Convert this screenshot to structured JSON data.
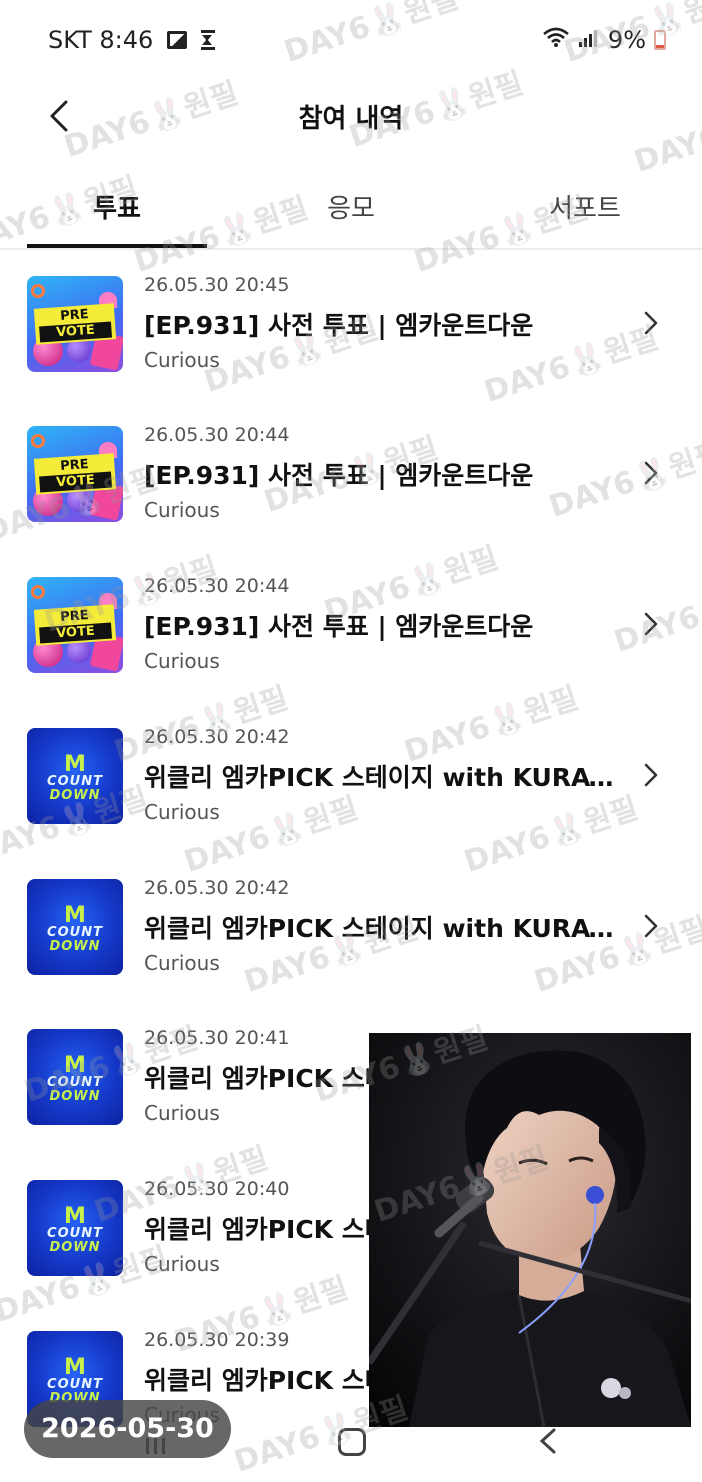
{
  "status_bar": {
    "carrier_time": "SKT 8:46",
    "battery": "9%"
  },
  "header": {
    "title": "참여 내역"
  },
  "tabs": [
    {
      "label": "투표",
      "active": true
    },
    {
      "label": "응모",
      "active": false
    },
    {
      "label": "서포트",
      "active": false
    }
  ],
  "thumbnails": {
    "pre_vote": {
      "line1": "PRE",
      "line2": "VOTE"
    },
    "countdown": {
      "m": "M",
      "line1": "COUNT",
      "line2": "DOWN"
    }
  },
  "items": [
    {
      "date": "26.05.30 20:45",
      "title": "[EP.931] 사전 투표 | 엠카운트다운",
      "subtitle": "Curious",
      "thumb": "pre_vote"
    },
    {
      "date": "26.05.30 20:44",
      "title": "[EP.931] 사전 투표 | 엠카운트다운",
      "subtitle": "Curious",
      "thumb": "pre_vote"
    },
    {
      "date": "26.05.30 20:44",
      "title": "[EP.931] 사전 투표 | 엠카운트다운",
      "subtitle": "Curious",
      "thumb": "pre_vote"
    },
    {
      "date": "26.05.30 20:42",
      "title": "위클리 엠카PICK 스테이지 with KURAT...",
      "subtitle": "Curious",
      "thumb": "countdown"
    },
    {
      "date": "26.05.30 20:42",
      "title": "위클리 엠카PICK 스테이지 with KURAT...",
      "subtitle": "Curious",
      "thumb": "countdown"
    },
    {
      "date": "26.05.30 20:41",
      "title": "위클리 엠카PICK 스테",
      "subtitle": "Curious",
      "thumb": "countdown"
    },
    {
      "date": "26.05.30 20:40",
      "title": "위클리 엠카PICK 스테",
      "subtitle": "Curious",
      "thumb": "countdown"
    },
    {
      "date": "26.05.30 20:39",
      "title": "위클리 엠카PICK 스테",
      "subtitle": "Curious",
      "thumb": "countdown"
    }
  ],
  "date_chip": "2026-05-30",
  "watermark_text": "DAY6🐰원필",
  "colors": {
    "text_primary": "#111111",
    "text_secondary": "#555555",
    "countdown_blue": "#1538c8",
    "countdown_green": "#c8f04a",
    "prevote_yellow": "#f5ec3a"
  }
}
